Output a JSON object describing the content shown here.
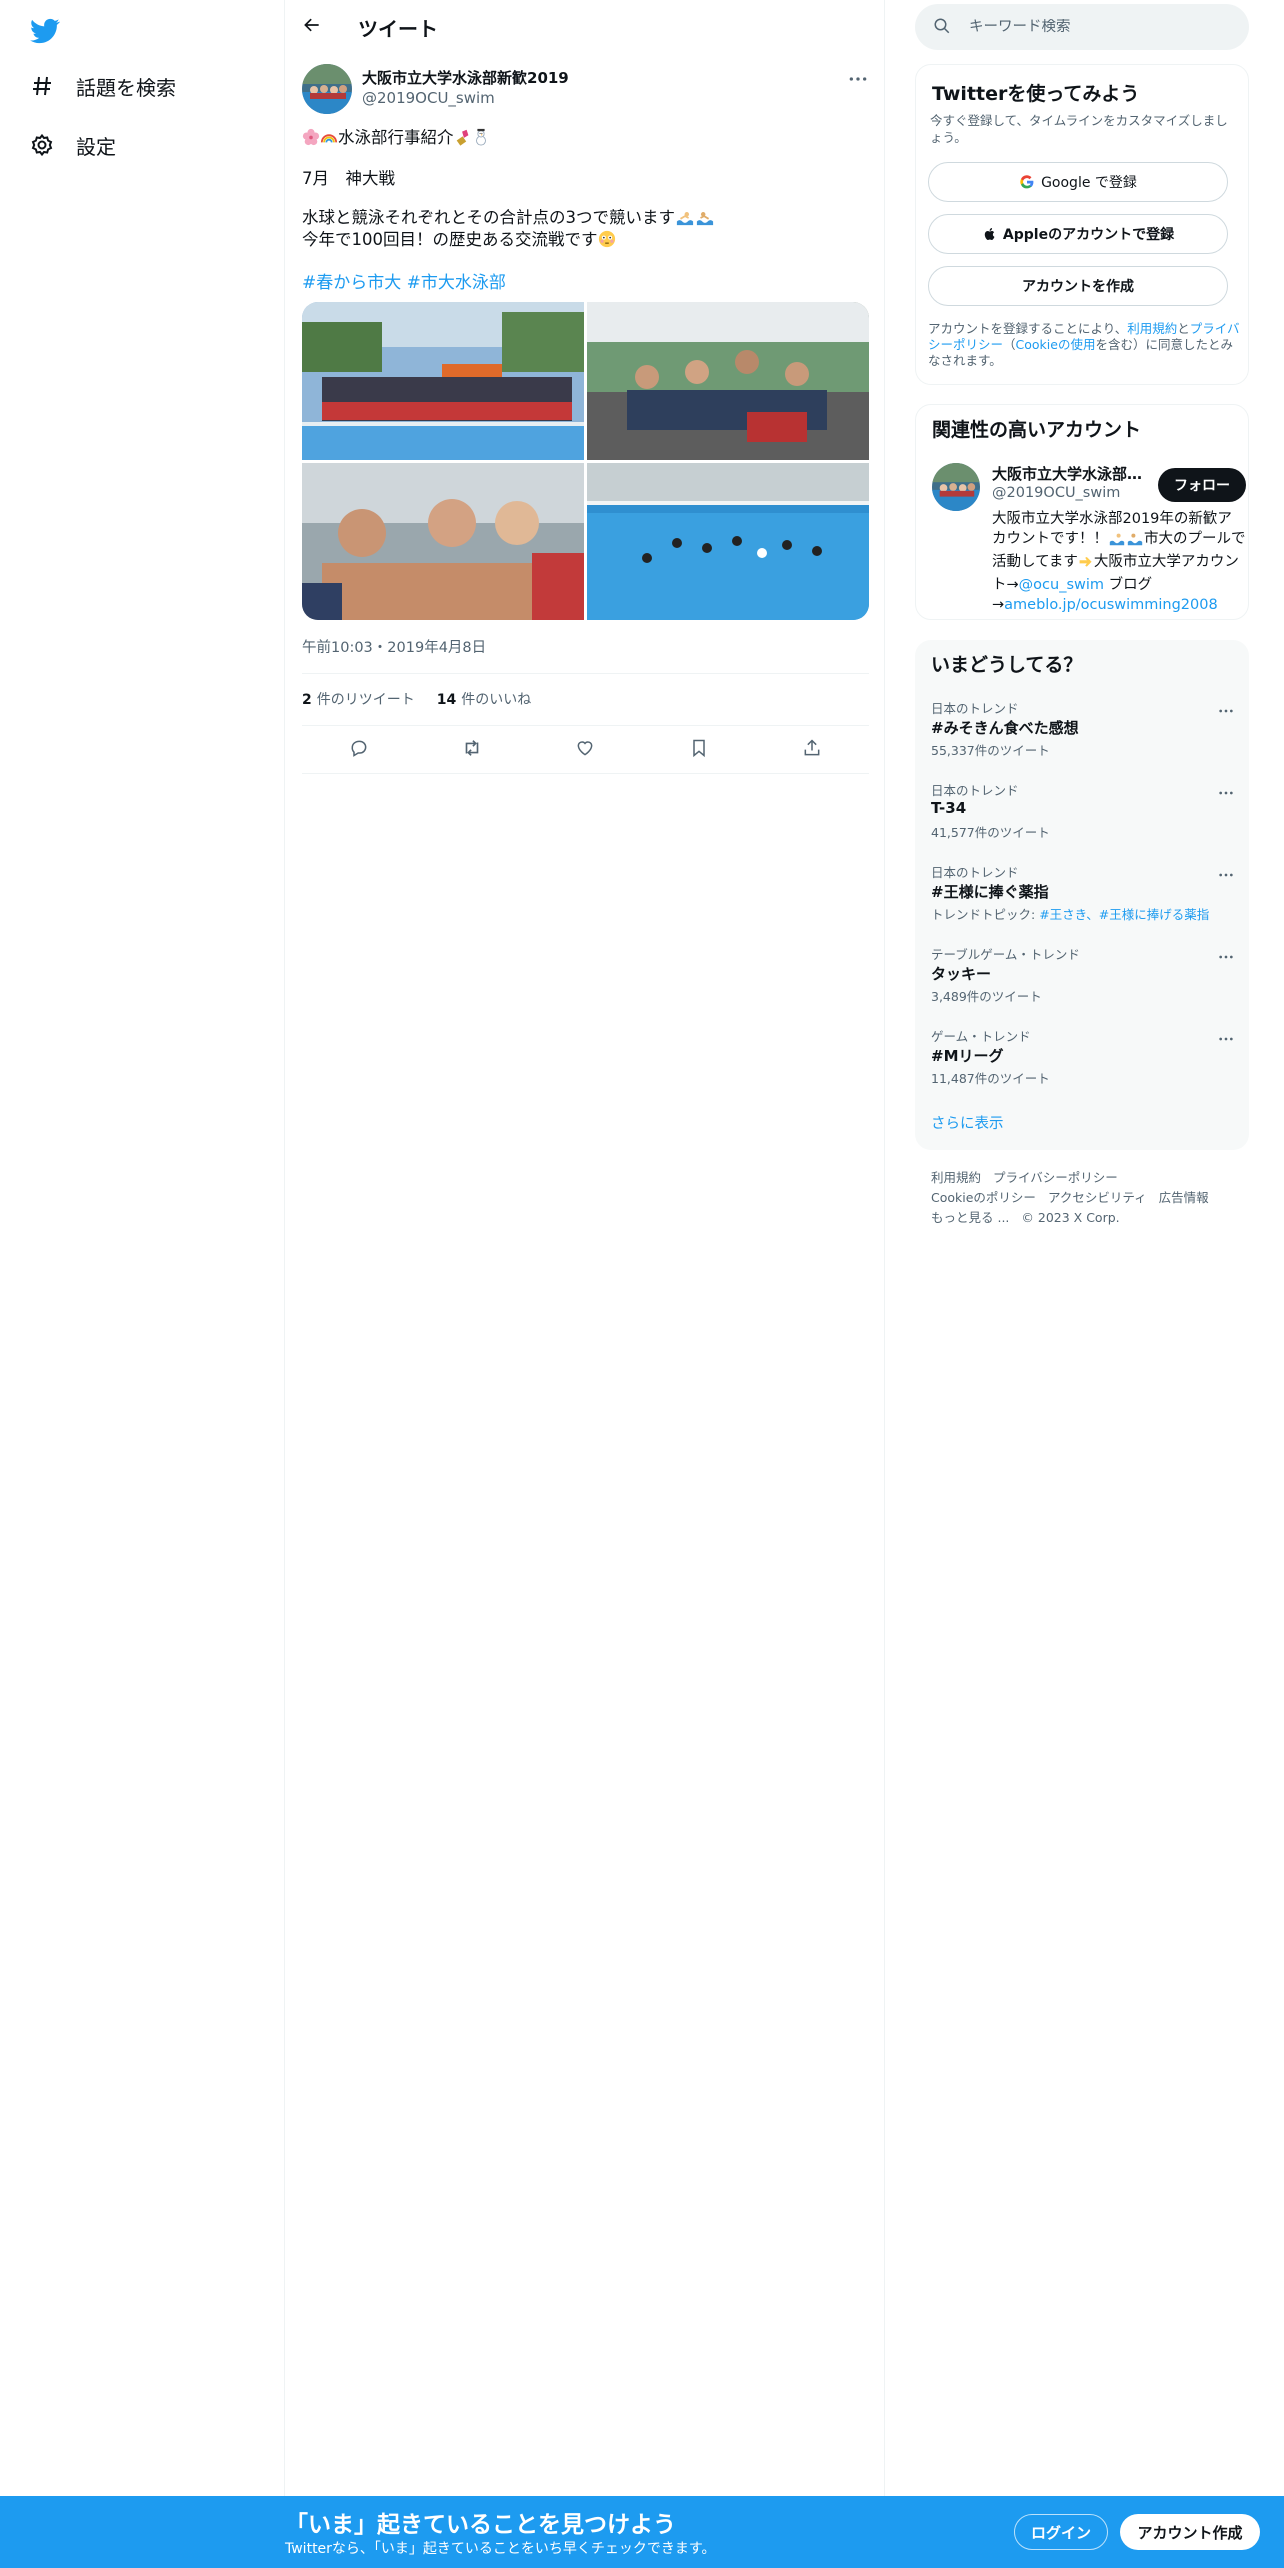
{
  "sidebar": {
    "logo": "twitter-bird-icon",
    "items": [
      {
        "label": "話題を検索",
        "icon": "hashtag-icon"
      },
      {
        "label": "設定",
        "icon": "gear-icon"
      }
    ]
  },
  "header": {
    "title": "ツイート"
  },
  "tweet": {
    "author_name": "大阪市立大学水泳部新歓2019",
    "author_handle": "@2019OCU_swim",
    "lines": [
      "水泳部行事紹介",
      "7月　神大戦",
      "水球と競泳それぞれとその合計点の3つで競います",
      "今年で100回目！の歴史ある交流戦です"
    ],
    "hashtags": [
      "#春から市大",
      "#市大水泳部"
    ],
    "timestamp": "午前10:03・2019年4月8日",
    "retweets_count": "2",
    "retweets_label": "件のリツイート",
    "likes_count": "14",
    "likes_label": "件のいいね",
    "actions": [
      "reply-icon",
      "retweet-icon",
      "like-icon",
      "bookmark-icon",
      "share-icon"
    ]
  },
  "search": {
    "placeholder": "キーワード検索"
  },
  "signup": {
    "title": "Twitterを使ってみよう",
    "subtitle": "今すぐ登録して、タイムラインをカスタマイズしましょう。",
    "google": "Google で登録",
    "apple": "Appleのアカウントで登録",
    "create": "アカウントを作成",
    "legal_1": "アカウントを登録することにより、",
    "legal_terms": "利用規約",
    "legal_2": "と",
    "legal_privacy": "プライバシーポリシー",
    "legal_3": "（",
    "legal_cookie": "Cookieの使用",
    "legal_4": "を含む）に同意したとみなされます。"
  },
  "related": {
    "title": "関連性の高いアカウント",
    "name": "大阪市立大学水泳部新歓2019",
    "handle": "@2019OCU_swim",
    "follow": "フォロー",
    "bio_1": "大阪市立大学水泳部2019年の新歓アカウントです！！",
    "bio_2": "市大のプールで活動してます",
    "bio_3": "大阪市立大学アカウント→",
    "bio_link1": "@ocu_swim",
    "bio_4": " ブログ→",
    "bio_link2": "ameblo.jp/ocuswimming2008"
  },
  "trends": {
    "title": "いまどうしてる？",
    "items": [
      {
        "meta": "日本のトレンド",
        "name": "#みそきん食べた感想",
        "count": "55,337件のツイート"
      },
      {
        "meta": "日本のトレンド",
        "name": "T-34",
        "count": "41,577件のツイート"
      },
      {
        "meta": "日本のトレンド",
        "name": "#王様に捧ぐ薬指",
        "count_prefix": "トレンドトピック: ",
        "count_link": "#王さき、#王様に捧げる薬指"
      },
      {
        "meta": "テーブルゲーム・トレンド",
        "name": "タッキー",
        "count": "3,489件のツイート"
      },
      {
        "meta": "ゲーム・トレンド",
        "name": "#Mリーグ",
        "count": "11,487件のツイート"
      }
    ],
    "show_more": "さらに表示"
  },
  "footer": {
    "terms": "利用規約",
    "privacy": "プライバシーポリシー",
    "cookie": "Cookieのポリシー",
    "accessibility": "アクセシビリティ",
    "ads": "広告情報",
    "more": "もっと見る ...",
    "copyright": "© 2023 X Corp."
  },
  "bottom_bar": {
    "title": "「いま」起きていることを見つけよう",
    "subtitle": "Twitterなら、「いま」起きていることをいち早くチェックできます。",
    "login": "ログイン",
    "signup": "アカウント作成"
  },
  "colors": {
    "accent": "#1d9bf0",
    "text": "#0f1419",
    "muted": "#536471",
    "banner": "#1d9bf0"
  }
}
